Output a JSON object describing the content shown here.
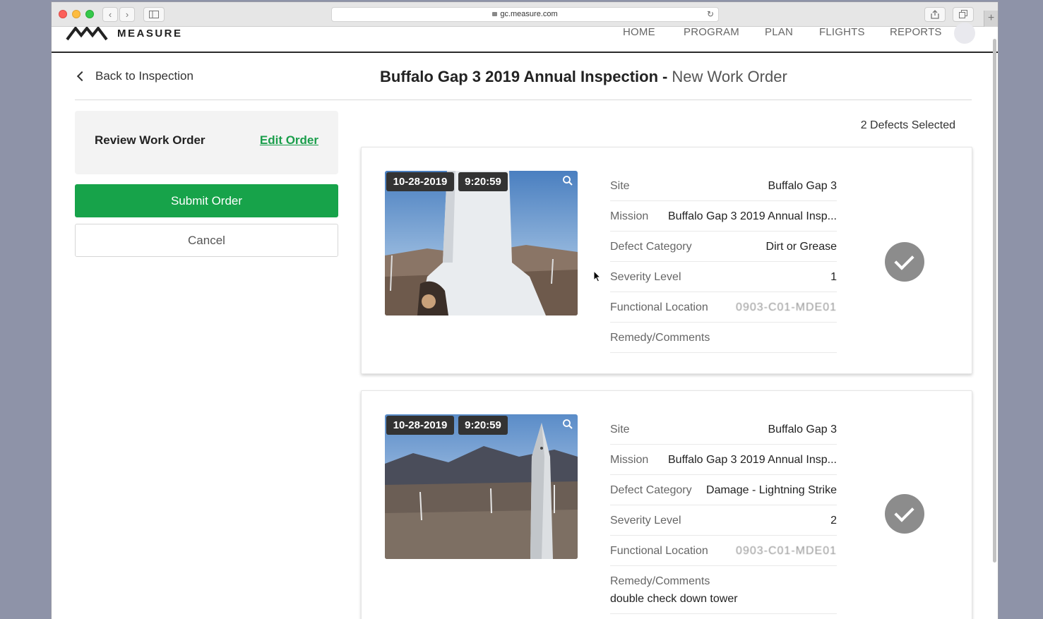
{
  "browser": {
    "url": "gc.measure.com"
  },
  "nav": {
    "logo": "MEASURE",
    "links": [
      "HOME",
      "PROGRAM",
      "PLAN",
      "FLIGHTS",
      "REPORTS"
    ]
  },
  "header": {
    "back_label": "Back to Inspection",
    "title": "Buffalo Gap 3 2019 Annual Inspection",
    "separator": "-",
    "subtitle": "New Work Order"
  },
  "sidebar": {
    "review_label": "Review Work Order",
    "edit_label": "Edit Order",
    "submit_label": "Submit Order",
    "cancel_label": "Cancel"
  },
  "selection": {
    "count_text": "2 Defects Selected"
  },
  "defects": [
    {
      "date": "10-28-2019",
      "time": "9:20:59",
      "site_label": "Site",
      "site": "Buffalo Gap 3",
      "mission_label": "Mission",
      "mission": "Buffalo Gap 3 2019 Annual Insp...",
      "category_label": "Defect Category",
      "category": "Dirt or Grease",
      "severity_label": "Severity Level",
      "severity": "1",
      "location_label": "Functional Location",
      "location": "0903-C01-MDE01",
      "remedy_label": "Remedy/Comments",
      "remedy": ""
    },
    {
      "date": "10-28-2019",
      "time": "9:20:59",
      "site_label": "Site",
      "site": "Buffalo Gap 3",
      "mission_label": "Mission",
      "mission": "Buffalo Gap 3 2019 Annual Insp...",
      "category_label": "Defect Category",
      "category": "Damage - Lightning Strike",
      "severity_label": "Severity Level",
      "severity": "2",
      "location_label": "Functional Location",
      "location": "0903-C01-MDE01",
      "remedy_label": "Remedy/Comments",
      "remedy": "double check down tower"
    }
  ],
  "colors": {
    "accent_green": "#17a34a",
    "link_green": "#1a9e4b",
    "check_gray": "#8c8c8c"
  }
}
